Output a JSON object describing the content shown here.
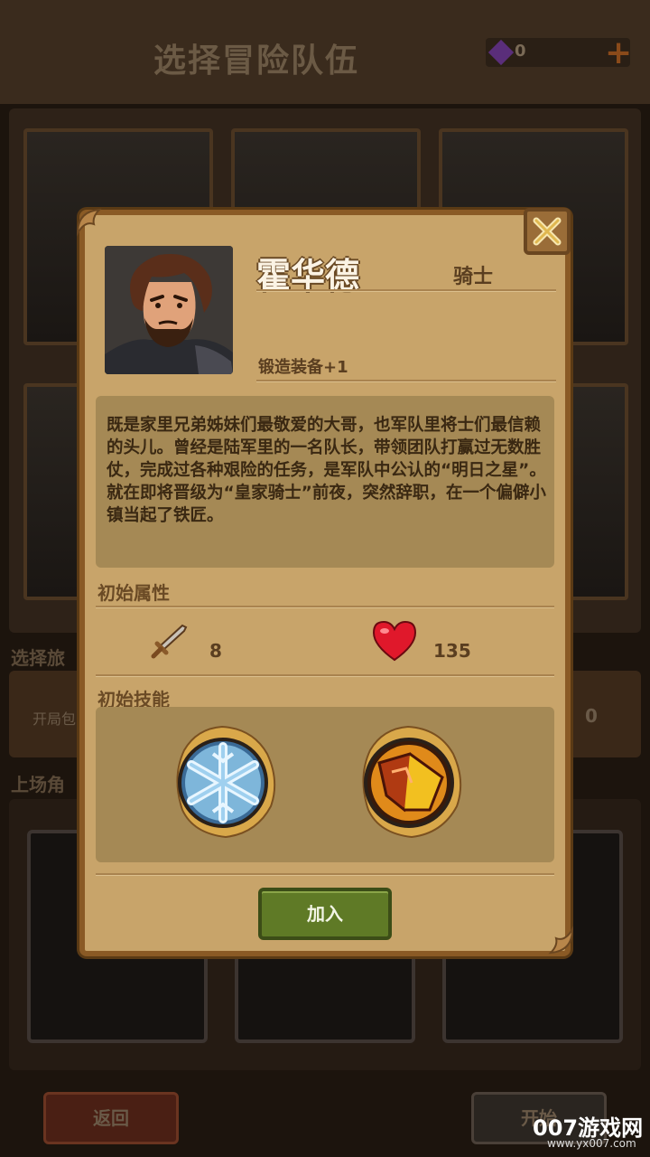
{
  "background": {
    "title": "选择冒险队伍",
    "gems": "0",
    "plus": "+",
    "travel_label": "选择旅",
    "pack_label": "开局包",
    "pack_value": "0",
    "roster_label": "上场角",
    "back_label": "返回",
    "start_label": "开始"
  },
  "dialog": {
    "name": "霍华德",
    "class": "骑士",
    "perk": "锻造装备+1",
    "description": "既是家里兄弟姊妹们最敬爱的大哥，也军队里将士们最信赖的头儿。曾经是陆军里的一名队长，带领团队打赢过无数胜仗，完成过各种艰险的任务，是军队中公认的“明日之星”。就在即将晋级为“皇家骑士”前夜，突然辞职，在一个偏僻小镇当起了铁匠。",
    "attributes_title": "初始属性",
    "attack_value": "8",
    "health_value": "135",
    "skills_title": "初始技能",
    "join_label": "加入"
  },
  "watermark": {
    "main": "007游戏网",
    "sub": "www.yx007.com"
  },
  "colors": {
    "dialog_bg": "#c8a46a",
    "dialog_border": "#8a5a25",
    "join_button": "#5f7a26",
    "heart": "#e0182b"
  }
}
